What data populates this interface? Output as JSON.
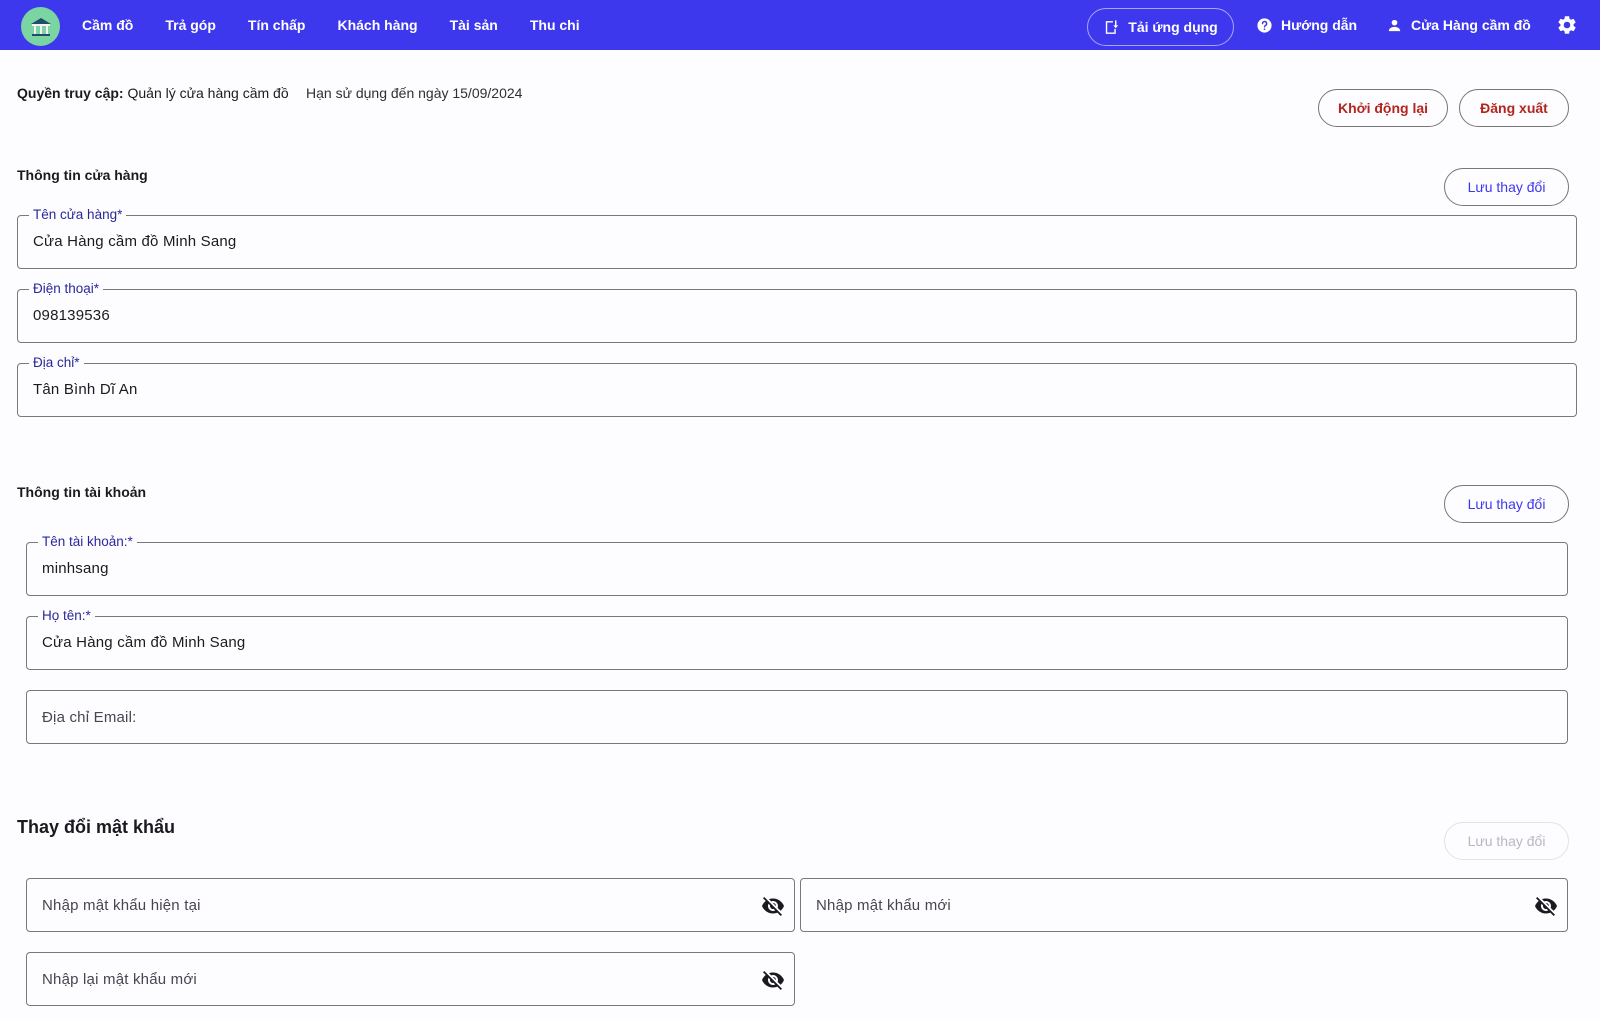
{
  "nav": {
    "items": [
      "Cầm đồ",
      "Trả góp",
      "Tín chấp",
      "Khách hàng",
      "Tài sản",
      "Thu chi"
    ],
    "download_app": "Tải ứng dụng",
    "guide": "Hướng dẫn",
    "store_account": "Cửa Hàng cầm đồ",
    "bar_color": "#3d38ed"
  },
  "header": {
    "access_label": "Quyền truy cập:",
    "access_value": "Quản lý cửa hàng cầm đồ",
    "expiry": "Hạn sử dụng đến ngày 15/09/2024",
    "restart": "Khởi động lại",
    "logout": "Đăng xuất"
  },
  "store_info": {
    "title": "Thông tin cửa hàng",
    "save": "Lưu thay đổi",
    "name_label": "Tên cửa hàng*",
    "name_value": "Cửa Hàng cầm đồ Minh Sang",
    "phone_label": "Điện thoại*",
    "phone_value": "098139536",
    "address_label": "Địa chỉ*",
    "address_value": "Tân Bình Dĩ An"
  },
  "account_info": {
    "title": "Thông tin tài khoản",
    "save": "Lưu thay đổi",
    "username_label": "Tên tài khoản:*",
    "username_value": "minhsang",
    "fullname_label": "Họ tên:*",
    "fullname_value": "Cửa Hàng cầm đồ Minh Sang",
    "email_placeholder": "Địa chỉ Email:"
  },
  "password": {
    "title": "Thay đổi mật khẩu",
    "save": "Lưu thay đổi",
    "current_placeholder": "Nhập mật khẩu hiện tại",
    "new_placeholder": "Nhập mật khẩu mới",
    "confirm_placeholder": "Nhập lại mật khẩu mới"
  }
}
